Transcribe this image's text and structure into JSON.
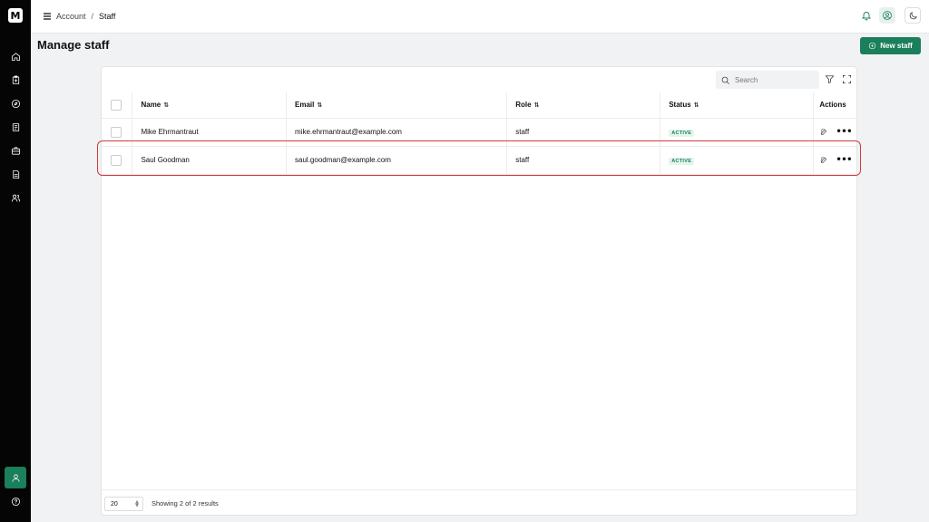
{
  "app": {
    "logo_glyph": "M"
  },
  "sidebar": {
    "items": [
      {
        "icon": "home-icon"
      },
      {
        "icon": "clipboard-icon"
      },
      {
        "icon": "compass-icon"
      },
      {
        "icon": "document-list-icon"
      },
      {
        "icon": "briefcase-icon"
      },
      {
        "icon": "file-text-icon"
      },
      {
        "icon": "users-icon"
      }
    ],
    "active_item_icon": "user-icon",
    "help_icon": "help-circle-icon"
  },
  "header": {
    "breadcrumb": {
      "parent": "Account",
      "separator": "/",
      "current": "Staff"
    }
  },
  "page": {
    "title": "Manage staff",
    "new_button_label": "New staff"
  },
  "toolbar": {
    "search_placeholder": "Search"
  },
  "table": {
    "columns": [
      "Name",
      "Email",
      "Role",
      "Status",
      "Actions"
    ],
    "sort_glyph": "⇅",
    "rows": [
      {
        "name": "Mike Ehrmantraut",
        "email": "mike.ehrmantraut@example.com",
        "role": "staff",
        "status": "ACTIVE"
      },
      {
        "name": "Saul Goodman",
        "email": "saul.goodman@example.com",
        "role": "staff",
        "status": "ACTIVE"
      }
    ]
  },
  "footer": {
    "page_size": "20",
    "results_text": "Showing 2 of 2 results"
  },
  "colors": {
    "brand": "#1a7f5a",
    "highlight": "#d03a3a",
    "sidebar_bg": "#050505"
  }
}
